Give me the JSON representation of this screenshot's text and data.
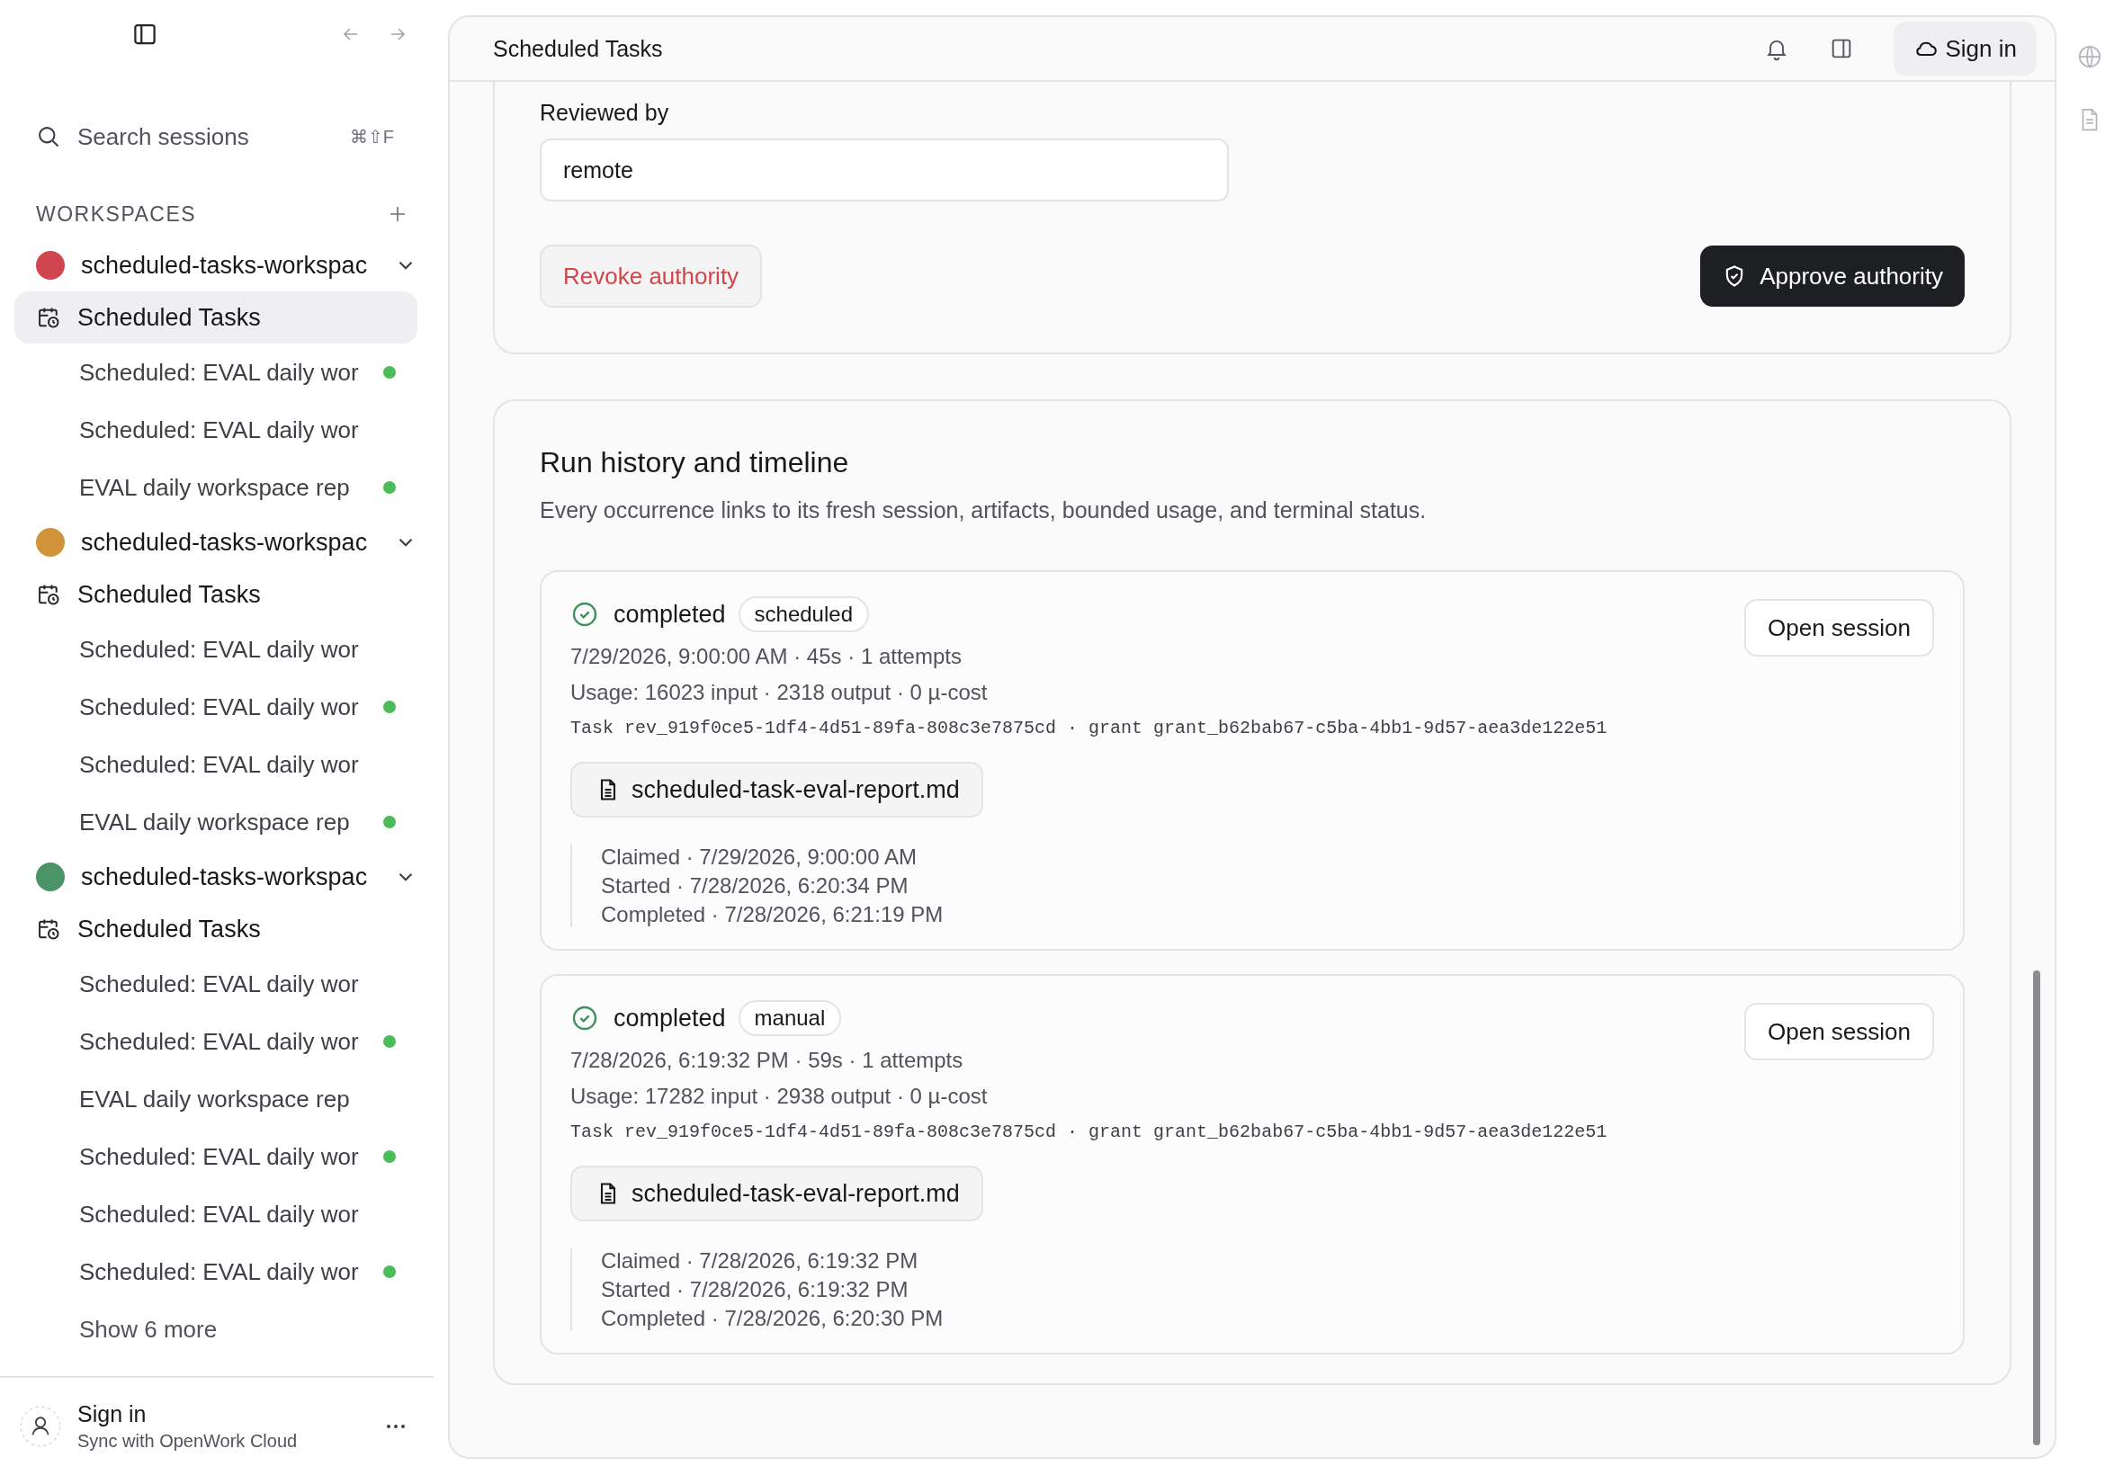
{
  "sidebar": {
    "search": {
      "placeholder": "Search sessions",
      "shortcut": "⌘⇧F"
    },
    "section_title": "WORKSPACES",
    "workspaces": [
      {
        "name": "scheduled-tasks-workspac",
        "color": "#d1454f",
        "items": [
          {
            "kind": "tasks",
            "label": "Scheduled Tasks",
            "selected": true,
            "active": false
          },
          {
            "kind": "session",
            "label": "Scheduled: EVAL daily wor",
            "selected": false,
            "active": true
          },
          {
            "kind": "session",
            "label": "Scheduled: EVAL daily wor",
            "selected": false,
            "active": false
          },
          {
            "kind": "session",
            "label": "EVAL daily workspace rep",
            "selected": false,
            "active": true
          }
        ]
      },
      {
        "name": "scheduled-tasks-workspac",
        "color": "#d0943a",
        "items": [
          {
            "kind": "tasks",
            "label": "Scheduled Tasks",
            "selected": false,
            "active": false
          },
          {
            "kind": "session",
            "label": "Scheduled: EVAL daily wor",
            "selected": false,
            "active": false
          },
          {
            "kind": "session",
            "label": "Scheduled: EVAL daily wor",
            "selected": false,
            "active": true
          },
          {
            "kind": "session",
            "label": "Scheduled: EVAL daily wor",
            "selected": false,
            "active": false
          },
          {
            "kind": "session",
            "label": "EVAL daily workspace rep",
            "selected": false,
            "active": true
          }
        ]
      },
      {
        "name": "scheduled-tasks-workspac",
        "color": "#4a9468",
        "items": [
          {
            "kind": "tasks",
            "label": "Scheduled Tasks",
            "selected": false,
            "active": false
          },
          {
            "kind": "session",
            "label": "Scheduled: EVAL daily wor",
            "selected": false,
            "active": false
          },
          {
            "kind": "session",
            "label": "Scheduled: EVAL daily wor",
            "selected": false,
            "active": true
          },
          {
            "kind": "session",
            "label": "EVAL daily workspace rep",
            "selected": false,
            "active": false
          },
          {
            "kind": "session",
            "label": "Scheduled: EVAL daily wor",
            "selected": false,
            "active": true
          },
          {
            "kind": "session",
            "label": "Scheduled: EVAL daily wor",
            "selected": false,
            "active": false
          },
          {
            "kind": "session",
            "label": "Scheduled: EVAL daily wor",
            "selected": false,
            "active": true
          }
        ],
        "more": "Show 6 more"
      }
    ],
    "footer": {
      "title": "Sign in",
      "subtitle": "Sync with OpenWork Cloud"
    }
  },
  "header": {
    "title": "Scheduled Tasks",
    "sign_in": "Sign in"
  },
  "authority": {
    "label": "Reviewed by",
    "value": "remote",
    "revoke": "Revoke authority",
    "approve": "Approve authority"
  },
  "history": {
    "title": "Run history and timeline",
    "description": "Every occurrence links to its fresh session, artifacts, bounded usage, and terminal status.",
    "runs": [
      {
        "status": "completed",
        "trigger": "scheduled",
        "open": "Open session",
        "timing": "7/29/2026, 9:00:00 AM · 45s · 1 attempts",
        "usage": "Usage: 16023 input · 2318 output · 0 µ-cost",
        "ids": "Task rev_919f0ce5-1df4-4d51-89fa-808c3e7875cd · grant grant_b62bab67-c5ba-4bb1-9d57-aea3de122e51",
        "artifact": "scheduled-task-eval-report.md",
        "timeline": [
          "Claimed · 7/29/2026, 9:00:00 AM",
          "Started · 7/28/2026, 6:20:34 PM",
          "Completed · 7/28/2026, 6:21:19 PM"
        ]
      },
      {
        "status": "completed",
        "trigger": "manual",
        "open": "Open session",
        "timing": "7/28/2026, 6:19:32 PM · 59s · 1 attempts",
        "usage": "Usage: 17282 input · 2938 output · 0 µ-cost",
        "ids": "Task rev_919f0ce5-1df4-4d51-89fa-808c3e7875cd · grant grant_b62bab67-c5ba-4bb1-9d57-aea3de122e51",
        "artifact": "scheduled-task-eval-report.md",
        "timeline": [
          "Claimed · 7/28/2026, 6:19:32 PM",
          "Started · 7/28/2026, 6:19:32 PM",
          "Completed · 7/28/2026, 6:20:30 PM"
        ]
      }
    ]
  }
}
